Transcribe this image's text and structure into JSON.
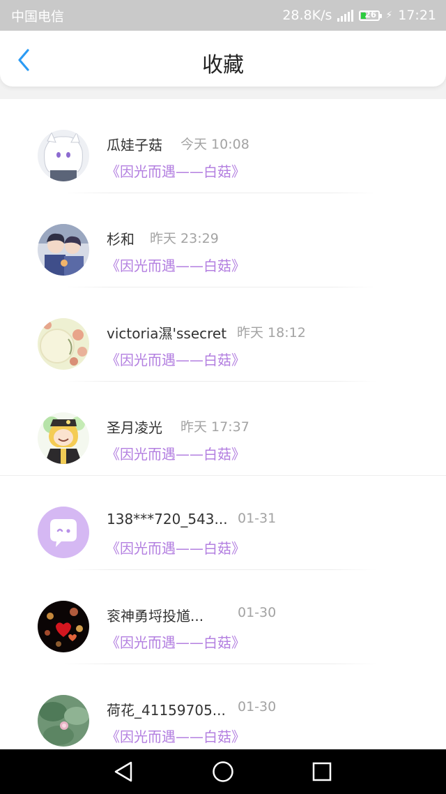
{
  "status_bar": {
    "carrier": "中国电信",
    "net_speed": "28.8K/s",
    "network": "4G",
    "battery": "26",
    "time": "17:21"
  },
  "header": {
    "title": "收藏",
    "back_icon": "chevron-left-icon",
    "accent_color": "#2b9bf4"
  },
  "favorites": [
    {
      "name": "瓜娃子菇",
      "time": "今天 10:08",
      "work": "《因光而遇——白菇》",
      "avatar": "anime-girl-white-hair"
    },
    {
      "name": "杉和",
      "time": "昨天 23:29",
      "work": "《因光而遇——白菇》",
      "avatar": "anime-couple"
    },
    {
      "name": "victoria濕'ssecret",
      "time": "昨天 18:12",
      "work": "《因光而遇——白菇》",
      "avatar": "floral-pastel"
    },
    {
      "name": "圣月凌光",
      "time": "昨天 17:37",
      "work": "《因光而遇——白菇》",
      "avatar": "anime-boy-blond"
    },
    {
      "name": "138***720_543...",
      "time": "01-31",
      "work": "《因光而遇——白菇》",
      "avatar": "default-chat-bubble"
    },
    {
      "name": "衮神勇埒投馗...",
      "time": "01-30",
      "work": "《因光而遇——白菇》",
      "avatar": "bokeh-hearts"
    },
    {
      "name": "荷花_41159705...",
      "time": "01-30",
      "work": "《因光而遇——白菇》",
      "avatar": "lotus-leaves"
    }
  ],
  "colors": {
    "link_purple": "#b37fe0",
    "time_gray": "#a3a3a3",
    "status_bar_bg": "#c9c9c9"
  },
  "nav_bar": {
    "back_icon": "triangle-back-icon",
    "home_icon": "circle-home-icon",
    "recents_icon": "square-recents-icon"
  }
}
